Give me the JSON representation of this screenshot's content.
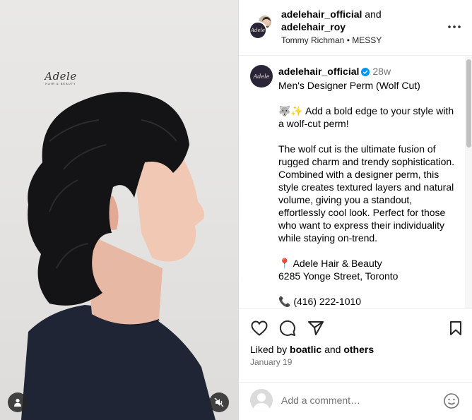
{
  "media": {
    "logo_big": "Adele",
    "logo_small": "HAIR & BEAUTY",
    "icons": {
      "tag": "person-tag-icon",
      "mute": "speaker-muted-icon"
    }
  },
  "header": {
    "user1": "adelehair_official",
    "joiner": "and",
    "user2": "adelehair_roy",
    "audio_artist": "Tommy Richman",
    "audio_sep": "•",
    "audio_track": "MESSY",
    "more_icon": "more-horizontal-icon"
  },
  "caption": {
    "username": "adelehair_official",
    "time": "28w",
    "title": "Men's Designer Perm (Wolf Cut)",
    "hook": "🐺✨ Add a bold edge to your style with a wolf-cut perm!",
    "body": "The wolf cut is the ultimate fusion of rugged charm and trendy sophistication. Combined with a designer perm, this style creates textured layers and natural volume, giving you a standout, effortlessly cool look. Perfect for those who want to express their individuality while staying on-trend.",
    "location_pin": "📍",
    "location_name": "Adele Hair & Beauty",
    "address": "6285 Yonge Street, Toronto",
    "phone_line": "📞 (416) 222-1010"
  },
  "actions": {
    "icons": [
      "heart-icon",
      "comment-icon",
      "share-icon",
      "bookmark-icon"
    ],
    "liked_prefix": "Liked by",
    "liked_user": "boatlic",
    "liked_and": "and",
    "liked_others": "others",
    "date": "January 19"
  },
  "comment": {
    "placeholder": "Add a comment…",
    "emoji_icon": "emoji-smile-icon"
  },
  "colors": {
    "verified": "#0095f6",
    "secondary_text": "#737373",
    "border": "#dbdbdb"
  }
}
